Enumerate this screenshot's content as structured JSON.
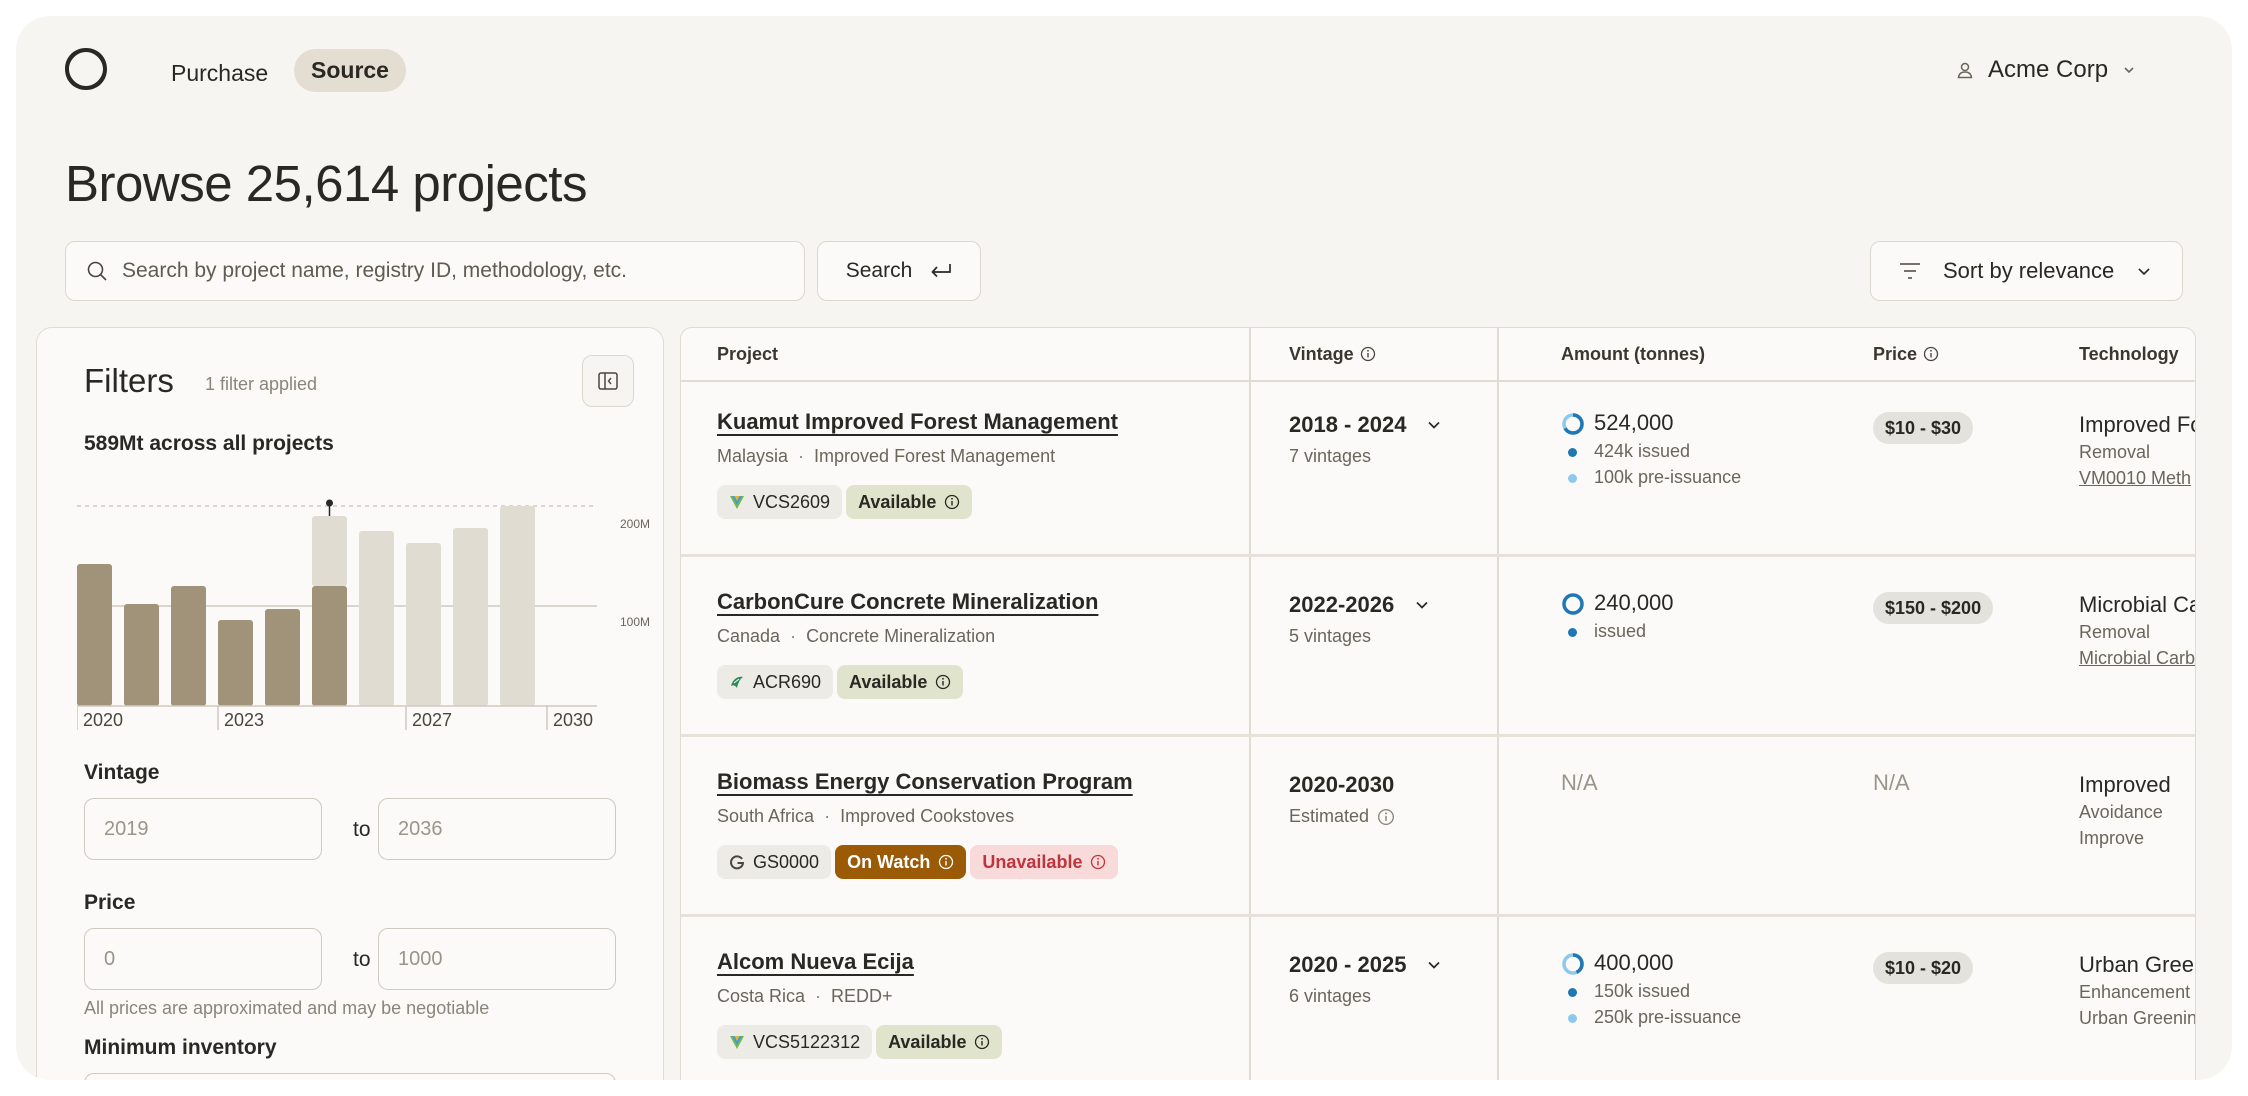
{
  "nav": {
    "purchase": "Purchase",
    "source": "Source"
  },
  "account": {
    "name": "Acme Corp"
  },
  "title": "Browse 25,614 projects",
  "search": {
    "placeholder": "Search by project name, registry ID, methodology, etc.",
    "button": "Search"
  },
  "sort": {
    "label": "Sort by relevance"
  },
  "filters": {
    "title": "Filters",
    "applied": "1 filter applied",
    "chart_caption": "589Mt across all projects",
    "vintage": {
      "label": "Vintage",
      "from_placeholder": "2019",
      "to_placeholder": "2036",
      "to": "to"
    },
    "price": {
      "label": "Price",
      "from_placeholder": "0",
      "to_placeholder": "1000",
      "to": "to",
      "note": "All prices are approximated and may be negotiable"
    },
    "min_inventory": {
      "label": "Minimum inventory"
    }
  },
  "chart_data": {
    "type": "bar",
    "categories": [
      "2020",
      "2021",
      "2022",
      "2023",
      "2024",
      "2025",
      "2026",
      "2027",
      "2028",
      "2029",
      "2030"
    ],
    "x_tick_labels": [
      "2020",
      "2023",
      "2027",
      "2030"
    ],
    "series": [
      {
        "values": [
          142,
          102,
          120,
          86,
          97,
          120,
          0,
          0,
          0,
          0,
          0
        ]
      },
      {
        "values": [
          0,
          0,
          0,
          0,
          0,
          70,
          175,
          163,
          178,
          200,
          0
        ]
      }
    ],
    "y_tick_labels": [
      "200M",
      "100M"
    ],
    "ylim": [
      0,
      200
    ],
    "colors": {
      "issued": "#a0937a",
      "forecast": "#e1dcd1"
    }
  },
  "table": {
    "columns": {
      "project": "Project",
      "vintage": "Vintage",
      "amount": "Amount (tonnes)",
      "price": "Price",
      "technology": "Technology"
    },
    "rows": [
      {
        "name": "Kuamut Improved Forest Management",
        "country": "Malaysia",
        "category": "Improved Forest Management",
        "registry": "VCS2609",
        "status": "Available",
        "vintage": "2018 - 2024",
        "vintage_sub": "7 vintages",
        "amount": "524,000",
        "issued": "424k issued",
        "pre": "100k pre-issuance",
        "price": "$10 - $30",
        "tech": "Improved Fo",
        "tech_type": "Removal",
        "tech_method": "VM0010 Meth"
      },
      {
        "name": "CarbonCure Concrete Mineralization",
        "country": "Canada",
        "category": "Concrete Mineralization",
        "registry": "ACR690",
        "status": "Available",
        "vintage": "2022-2026",
        "vintage_sub": "5 vintages",
        "amount": "240,000",
        "issued": "issued",
        "price": "$150 - $200",
        "tech": "Microbial Ca",
        "tech_type": "Removal",
        "tech_method": "Microbial Carb"
      },
      {
        "name": "Biomass Energy Conservation Program",
        "country": "South Africa",
        "category": "Improved Cookstoves",
        "registry": "GS0000",
        "status": "On Watch",
        "status2": "Unavailable",
        "vintage": "2020-2030",
        "vintage_sub": "Estimated",
        "amount": "N/A",
        "price": "N/A",
        "tech": "Improved",
        "tech_type": "Avoidance",
        "tech_method": "Improve"
      },
      {
        "name": "Alcom Nueva Ecija",
        "country": "Costa Rica",
        "category": "REDD+",
        "registry": "VCS5122312",
        "status": "Available",
        "vintage": "2020 - 2025",
        "vintage_sub": "6 vintages",
        "amount": "400,000",
        "issued": "150k issued",
        "pre": "250k pre-issuance",
        "price": "$10 - $20",
        "tech": "Urban Gree",
        "tech_type": "Enhancement",
        "tech_method": "Urban Greenin"
      }
    ]
  }
}
